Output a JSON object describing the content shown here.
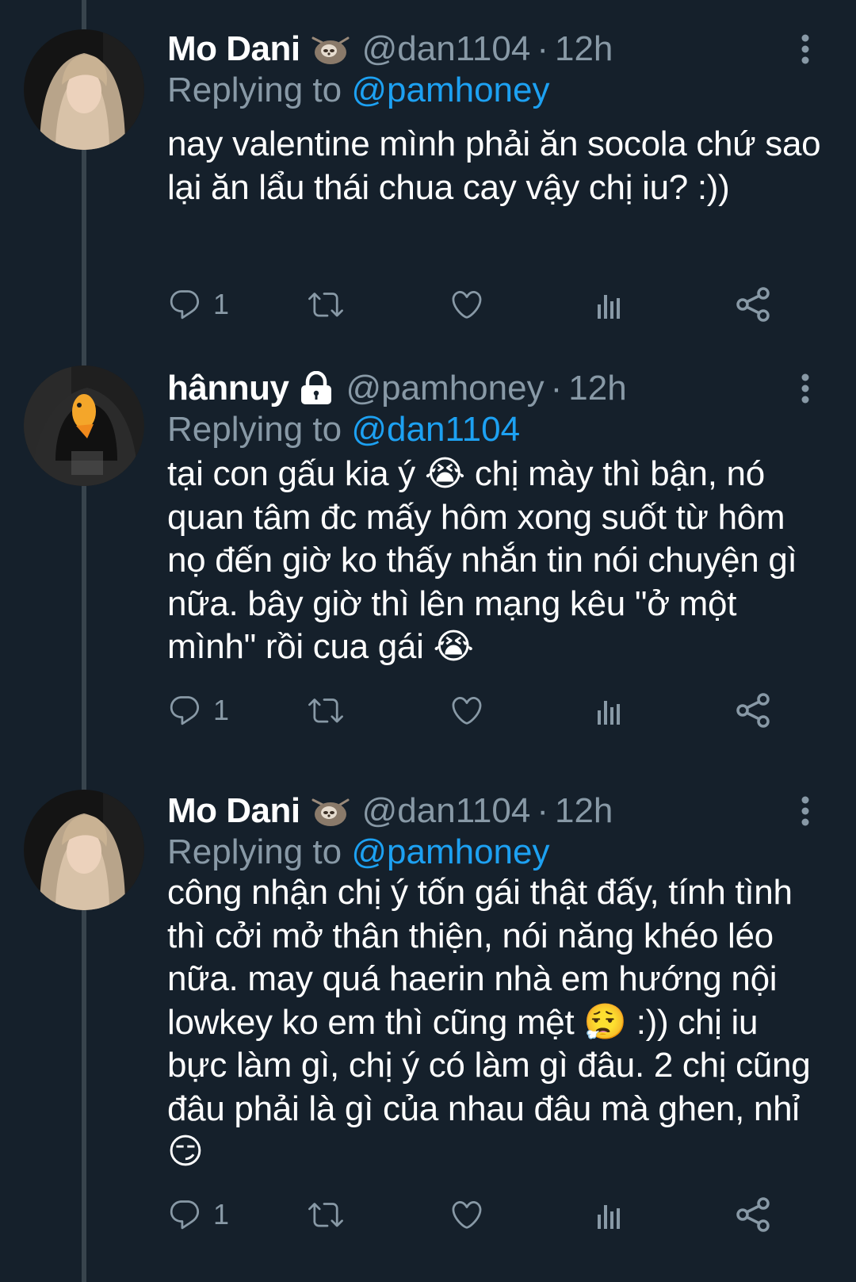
{
  "colors": {
    "background": "#15202b",
    "secondary_text": "#8899a6",
    "mention": "#1da1f2",
    "thread_line": "#38444d"
  },
  "tweets": [
    {
      "name": "Mo Dani",
      "name_badge": "sloth-emoji",
      "handle": "@dan1104",
      "separator": "·",
      "time": "12h",
      "replying_prefix": "Replying to ",
      "replying_to": "@pamhoney",
      "text": "nay valentine mình phải ăn socola chứ sao lại ăn lẩu thái chua cay vậy chị iu? :))",
      "reply_count": "1"
    },
    {
      "name": "hânnuy",
      "name_badge": "lock-icon",
      "handle": "@pamhoney",
      "separator": "·",
      "time": "12h",
      "replying_prefix": "Replying to ",
      "replying_to": "@dan1104",
      "text": "tại con gấu kia ý 😭 chị mày thì bận, nó quan tâm đc mấy hôm xong suốt từ hôm nọ đến giờ ko thấy nhắn tin nói chuyện gì nữa. bây giờ thì lên mạng kêu \"ở một mình\" rồi cua gái 😭",
      "reply_count": "1"
    },
    {
      "name": "Mo Dani",
      "name_badge": "sloth-emoji",
      "handle": "@dan1104",
      "separator": "·",
      "time": "12h",
      "replying_prefix": "Replying to ",
      "replying_to": "@pamhoney",
      "text": "công nhận chị ý tốn gái thật đấy, tính tình thì cởi mở thân thiện, nói năng khéo léo nữa. may quá haerin nhà em hướng nội lowkey ko em thì cũng mệt 😮‍💨 :)) chị iu bực làm gì, chị ý có làm gì đâu. 2 chị cũng đâu phải là gì của nhau đâu mà ghen, nhỉ 😏",
      "reply_count": "1"
    }
  ]
}
